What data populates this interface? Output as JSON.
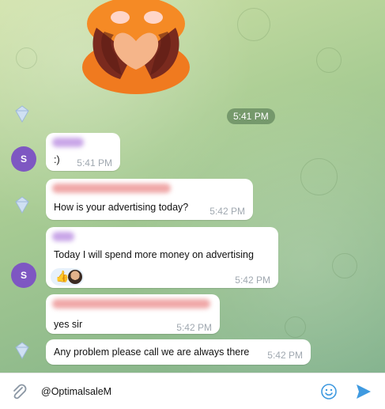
{
  "chat": {
    "date_pill": "5:41 PM",
    "messages": [
      {
        "text": ":)",
        "time": "5:41 PM",
        "avatar_letter": "S"
      },
      {
        "text": "How is your advertising today?",
        "time": "5:42 PM"
      },
      {
        "text": "Today I will spend more money on advertising",
        "time": "5:42 PM",
        "avatar_letter": "S",
        "reactions": [
          "thumbs-up",
          "user-photo"
        ]
      },
      {
        "text": "yes sir",
        "time": "5:42 PM"
      },
      {
        "text": "Any problem please call we are always there",
        "time": "5:42 PM"
      }
    ]
  },
  "composer": {
    "value": "@OptimalsaleM",
    "icons": [
      "paperclip-icon",
      "emoji-icon",
      "send-icon"
    ]
  },
  "colors": {
    "accent": "#3f9ae0",
    "avatar_purple": "#7e57c2",
    "meta_gray": "#a0a8b0"
  }
}
